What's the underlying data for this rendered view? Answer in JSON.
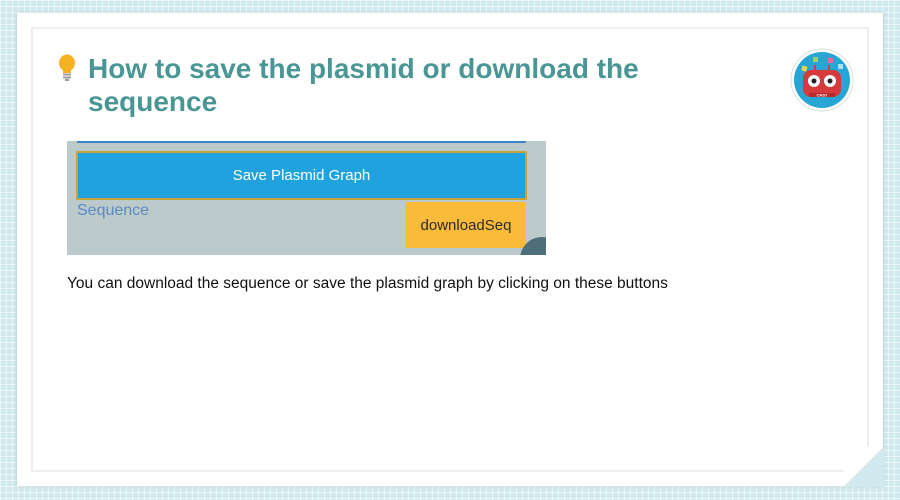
{
  "slide": {
    "title": "How to save the plasmid or download the sequence",
    "logo_text": "CAST",
    "description": "You can download the sequence or save the plasmid graph by clicking on these buttons"
  },
  "screenshot": {
    "save_button_label": "Save Plasmid Graph",
    "sequence_label": "Sequence",
    "download_button_label": "downloadSeq"
  },
  "icons": {
    "title": "lightbulb-icon",
    "logo": "cast-robot-logo-icon"
  },
  "colors": {
    "title": "#4a9694",
    "save_button": "#1fa2de",
    "download_button": "#fbbb3a",
    "screenshot_bg": "#bccacb",
    "page_bg": "#cfe9ee"
  }
}
